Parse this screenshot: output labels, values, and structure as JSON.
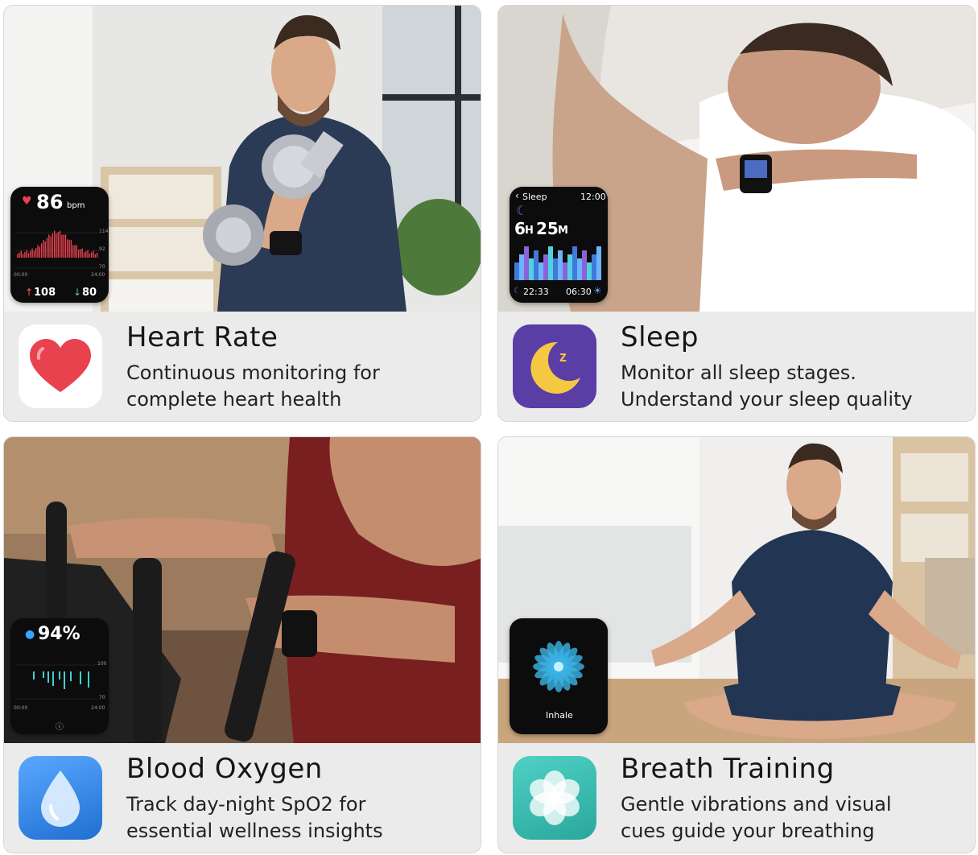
{
  "cards": [
    {
      "title": "Heart Rate",
      "desc": [
        "Continuous monitoring for",
        "complete heart health"
      ],
      "icon": "heart-icon",
      "watch": {
        "value": "86",
        "unit": "bpm",
        "scale": [
          "114",
          "92",
          "70"
        ],
        "times": [
          "00:00",
          "24:00"
        ],
        "max": "108",
        "min": "80"
      }
    },
    {
      "title": "Sleep",
      "desc": [
        "Monitor all sleep stages.",
        "Understand your sleep quality"
      ],
      "icon": "moon-icon",
      "watch": {
        "title": "Sleep",
        "clock": "12:00",
        "hours": "6",
        "hours_unit": "H",
        "minutes": "25",
        "minutes_unit": "M",
        "bed": "22:33",
        "wake": "06:30"
      }
    },
    {
      "title": "Blood Oxygen",
      "desc": [
        "Track day-night SpO2 for",
        "essential wellness insights"
      ],
      "icon": "water-drop-icon",
      "watch": {
        "value": "94%",
        "scale": [
          "100",
          "70"
        ],
        "times": [
          "00:00",
          "24:00"
        ]
      }
    },
    {
      "title": "Breath Training",
      "desc": [
        "Gentle vibrations and visual",
        "cues guide your breathing"
      ],
      "icon": "flower-icon",
      "watch": {
        "label": "Inhale"
      }
    }
  ],
  "colors": {
    "heart": "#e8424f",
    "sleep_icon_bg": "#5a3ea6",
    "moon": "#f5c842",
    "drop_bg": "#2f82e0",
    "breath_bg": "#3fc3b8",
    "sleep_bar": "#5a82d8"
  }
}
